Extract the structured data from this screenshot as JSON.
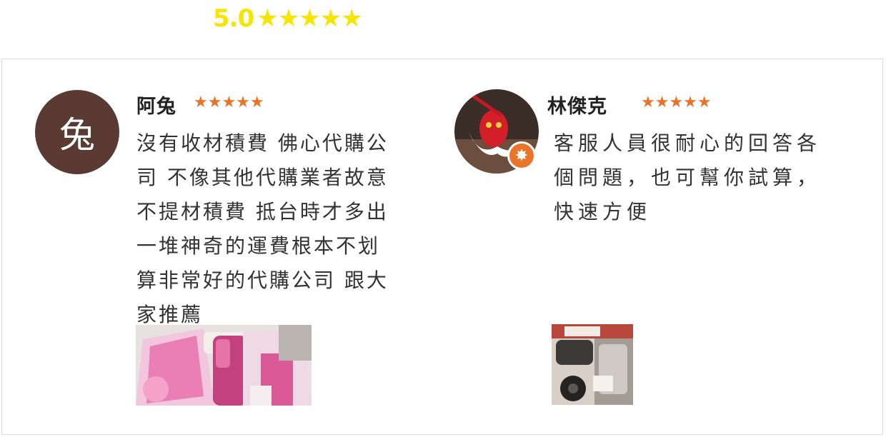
{
  "summary": {
    "value": "5.0",
    "stars": "★★★★★",
    "star_color": "#f5e500"
  },
  "reviews": [
    {
      "avatar_text": "兔",
      "name": "阿兔",
      "stars": "★★★★★",
      "text": "沒有收材積費 佛心代購公\n司 不像其他代購業者故意\n不提材積費 抵台時才多出\n一堆神奇的運費根本不划\n算非常好的代購公司 跟大\n家推薦",
      "photo": "mosquito-spray-product-icon"
    },
    {
      "avatar": "mask-avatar-icon",
      "badge": "orange-badge-icon",
      "name": "林傑克",
      "stars": "★★★★★",
      "text": "客服人員很耐心的回答各\n個問題，也可幫你試算，\n快速方便",
      "photo": "kitchen-appliance-product-icon"
    }
  ],
  "colors": {
    "review_star": "#e8742a",
    "avatar_bg": "#5a3a33"
  }
}
